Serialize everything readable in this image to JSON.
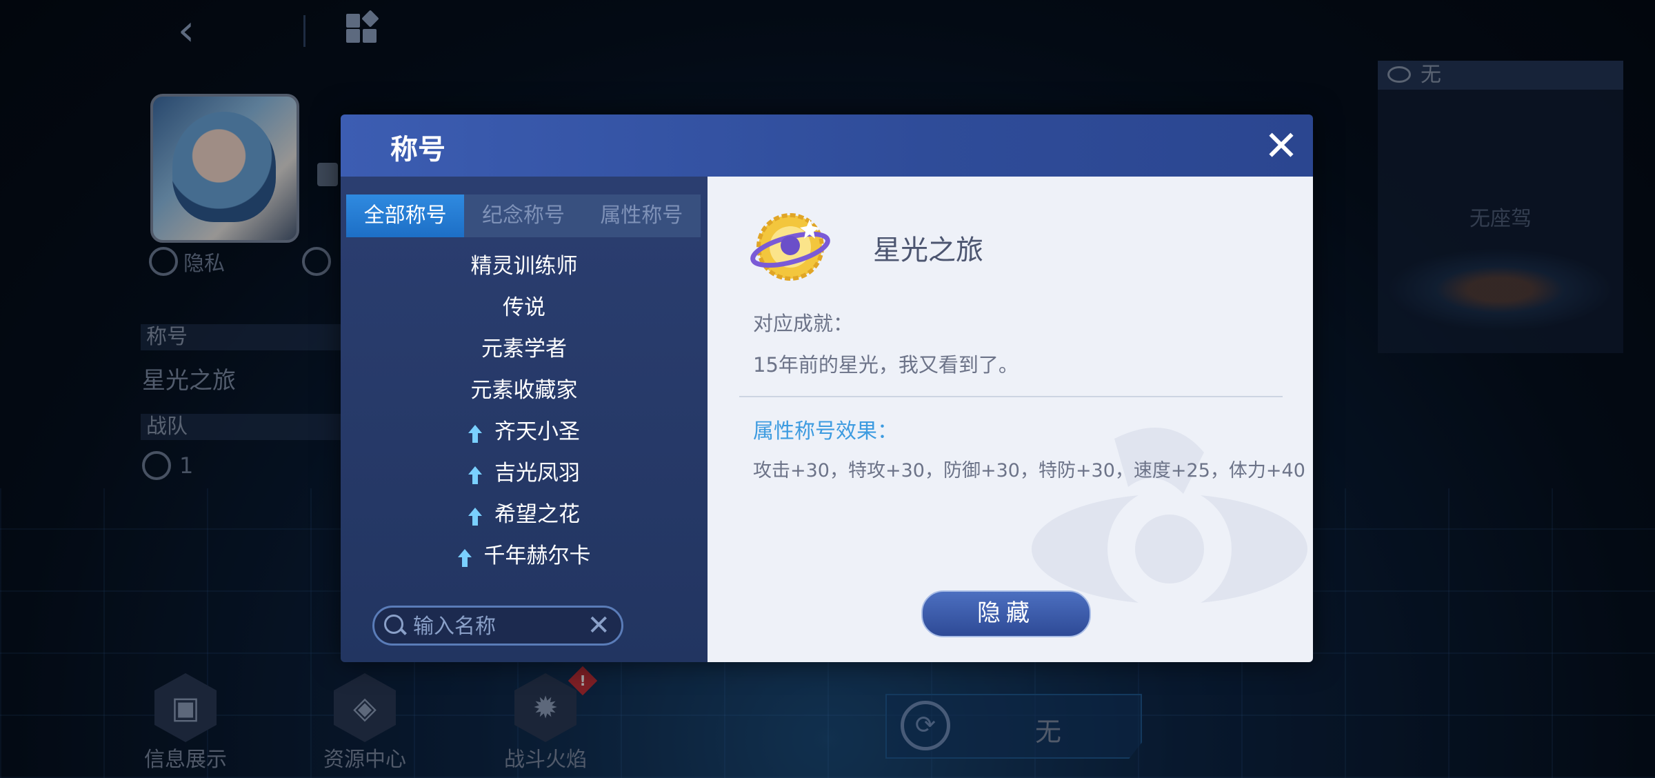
{
  "background": {
    "privacy_label": "隐私",
    "title_section_label": "称号",
    "title_value": "星光之旅",
    "team_label": "战队",
    "team_value": "1",
    "seat_header": "无",
    "seat_empty_text": "无座驾",
    "mount_label": "无",
    "bottom_buttons": [
      {
        "label": "信息展示",
        "icon": "id-card-icon"
      },
      {
        "label": "资源中心",
        "icon": "layers-icon"
      },
      {
        "label": "战斗火焰",
        "icon": "flame-icon",
        "alert": "!"
      }
    ]
  },
  "modal": {
    "title": "称号",
    "close_label": "✕",
    "tabs": [
      {
        "label": "全部称号",
        "active": true
      },
      {
        "label": "纪念称号",
        "active": false
      },
      {
        "label": "属性称号",
        "active": false
      }
    ],
    "titles": [
      {
        "label": "精灵训练师",
        "boosted": false
      },
      {
        "label": "传说",
        "boosted": false
      },
      {
        "label": "元素学者",
        "boosted": false
      },
      {
        "label": "元素收藏家",
        "boosted": false
      },
      {
        "label": "齐天小圣",
        "boosted": true
      },
      {
        "label": "吉光凤羽",
        "boosted": true
      },
      {
        "label": "希望之花",
        "boosted": true
      },
      {
        "label": "千年赫尔卡",
        "boosted": true
      }
    ],
    "search": {
      "placeholder": "输入名称",
      "value": ""
    },
    "detail": {
      "name": "星光之旅",
      "achievement_label": "对应成就：",
      "achievement_text": "15年前的星光，我又看到了。",
      "effect_label": "属性称号效果：",
      "effect_text": "攻击+30，特攻+30，防御+30，特防+30，速度+25，体力+40",
      "hide_button": "隐藏"
    }
  },
  "colors": {
    "accent": "#3d9be0",
    "tab_active": "#1d6fc6",
    "header": "#3c5db2"
  }
}
